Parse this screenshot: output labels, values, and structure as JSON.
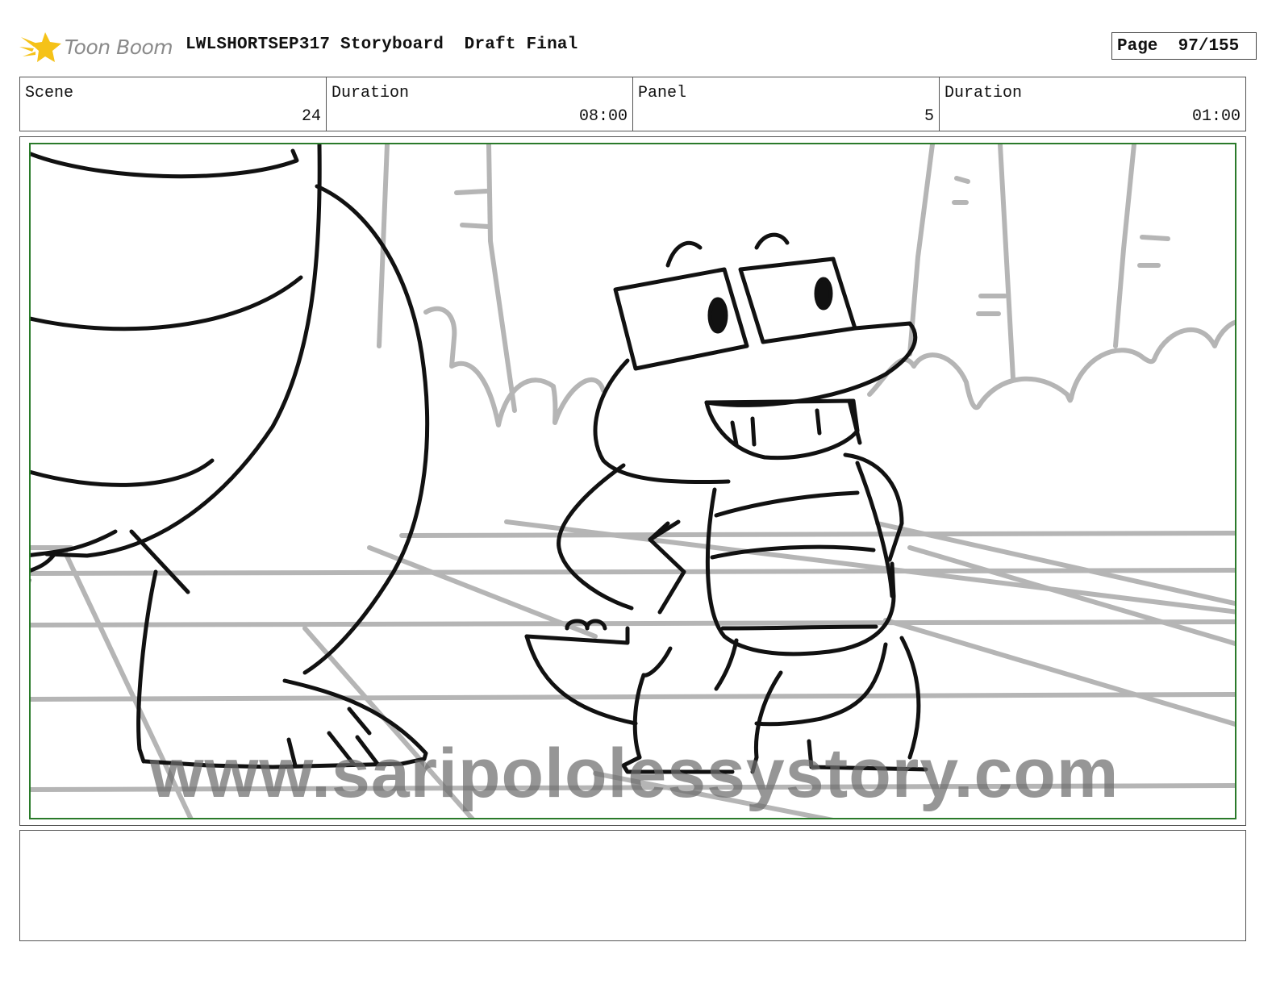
{
  "header": {
    "logo_text": "Toon Boom",
    "title": "LWLSHORTSEP317 Storyboard  Draft Final",
    "page_label": "Page",
    "page_value": "97/155"
  },
  "info": {
    "scene_label": "Scene",
    "scene_value": "24",
    "scene_duration_label": "Duration",
    "scene_duration_value": "08:00",
    "panel_label": "Panel",
    "panel_value": "5",
    "panel_duration_label": "Duration",
    "panel_duration_value": "01:00"
  },
  "panel": {
    "watermark": "www.saripololessystory.com"
  },
  "caption": {
    "text": ""
  },
  "colors": {
    "frame_border": "#555555",
    "safe_area": "#2a7a2a",
    "sketch_line": "#111111",
    "background_line": "#b5b5b5",
    "logo_star": "#f5c218"
  }
}
